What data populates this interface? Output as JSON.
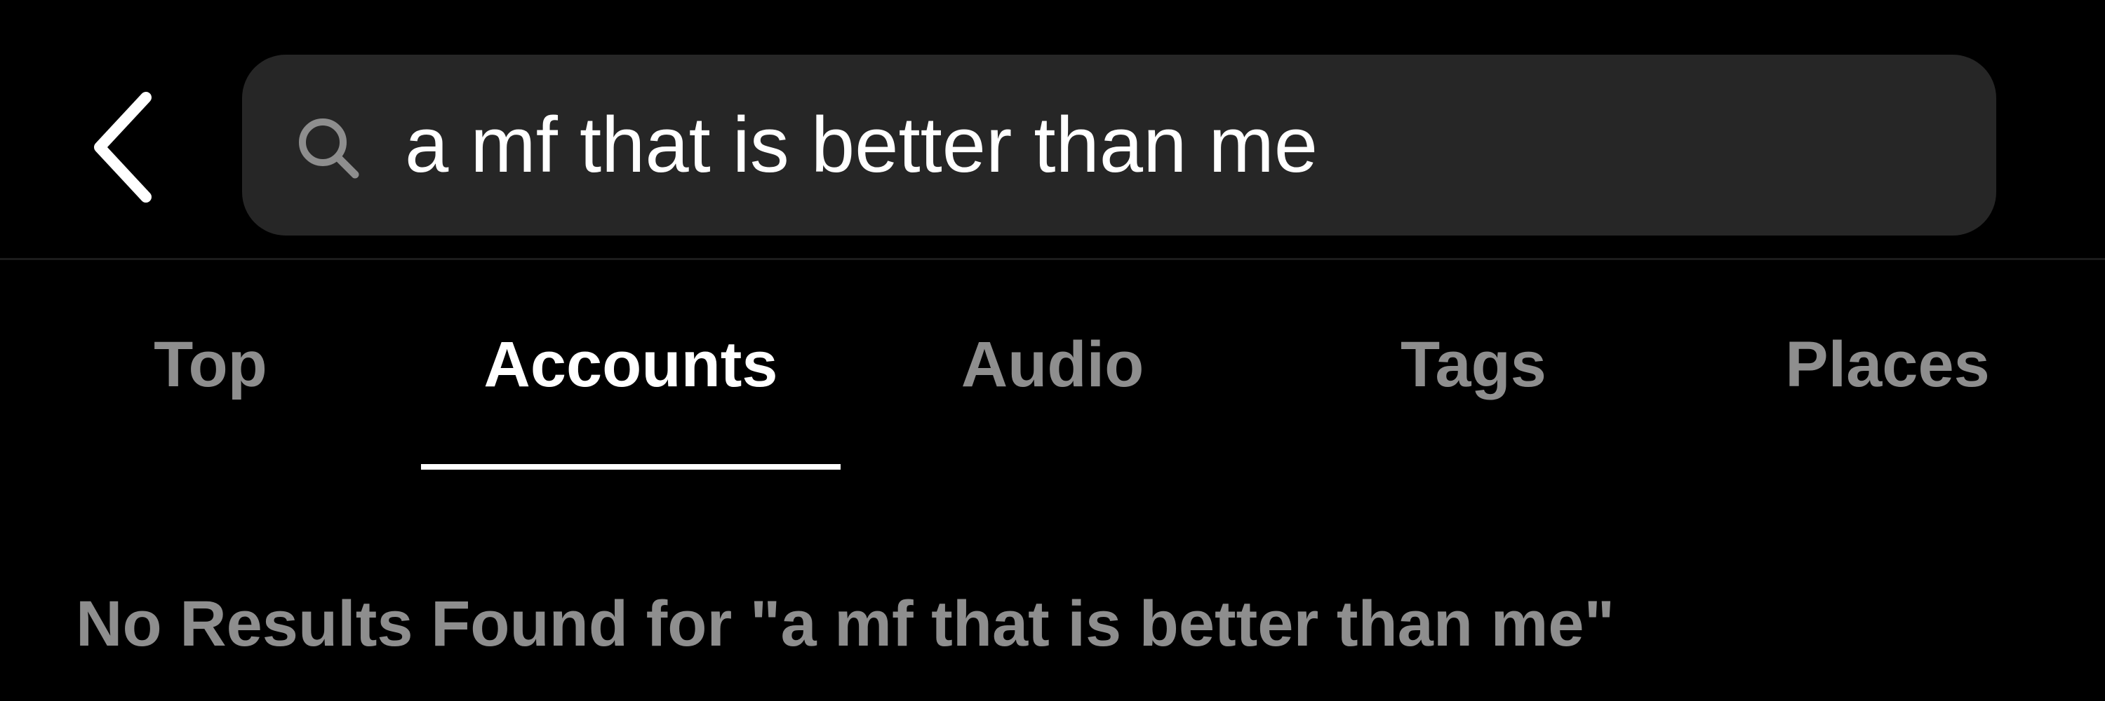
{
  "header": {
    "back_icon": "chevron-left-icon",
    "search": {
      "icon": "search-icon",
      "value": "a mf that is better than me"
    }
  },
  "tabs": [
    {
      "label": "Top",
      "active": false
    },
    {
      "label": "Accounts",
      "active": true
    },
    {
      "label": "Audio",
      "active": false
    },
    {
      "label": "Tags",
      "active": false
    },
    {
      "label": "Places",
      "active": false
    }
  ],
  "results": {
    "message": "No Results Found for \"a mf that is better than me\""
  },
  "colors": {
    "background": "#000000",
    "search_bar": "#262626",
    "active_text": "#ffffff",
    "inactive_text": "#8e8e8e",
    "icon_gray": "#8e8e8e"
  }
}
